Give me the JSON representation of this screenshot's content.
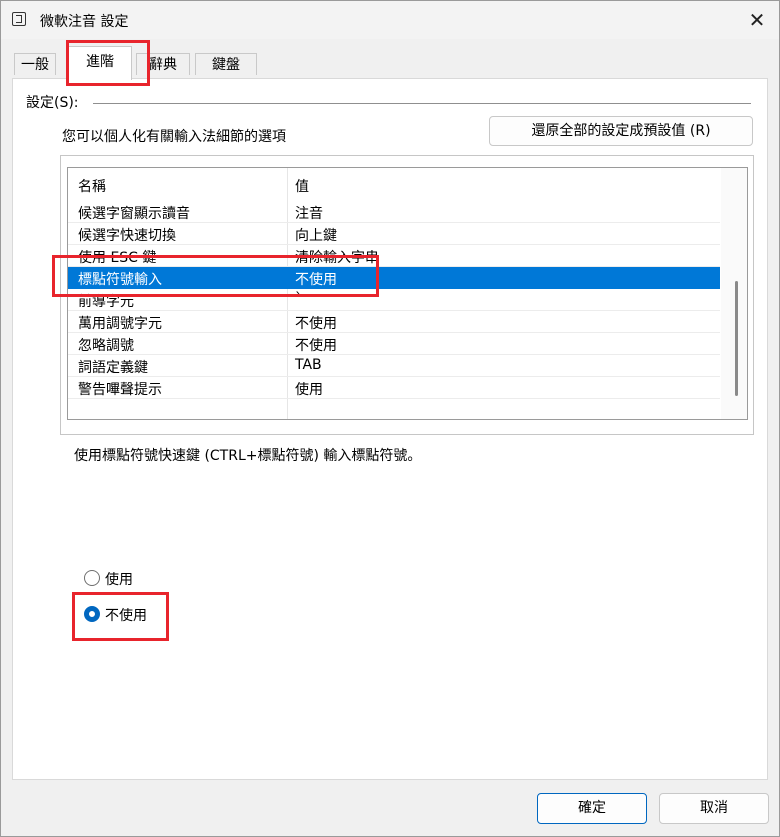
{
  "window": {
    "title": "微軟注音 設定",
    "close_glyph": "✕"
  },
  "tabs": [
    {
      "label": "一般"
    },
    {
      "label": "進階"
    },
    {
      "label": "辭典"
    },
    {
      "label": "鍵盤"
    }
  ],
  "settings": {
    "group_label": "設定(S):",
    "description": "您可以個人化有關輸入法細節的選項",
    "restore_button": "還原全部的設定成預設值 (R)",
    "columns": {
      "name": "名稱",
      "value": "值"
    },
    "rows": [
      {
        "name": "候選字窗顯示讀音",
        "value": "注音"
      },
      {
        "name": "候選字快速切換",
        "value": "向上鍵"
      },
      {
        "name": "使用 ESC 鍵",
        "value": "清除輸入字串"
      },
      {
        "name": "標點符號輸入",
        "value": "不使用"
      },
      {
        "name": "前導字元",
        "value": "`"
      },
      {
        "name": "萬用調號字元",
        "value": "不使用"
      },
      {
        "name": "忽略調號",
        "value": "不使用"
      },
      {
        "name": "詞語定義鍵",
        "value": "TAB"
      },
      {
        "name": "警告嗶聲提示",
        "value": "使用"
      }
    ],
    "selected_row": "標點符號輸入",
    "hint": "使用標點符號快速鍵 (CTRL+標點符號) 輸入標點符號。",
    "options": [
      {
        "label": "使用",
        "checked": false
      },
      {
        "label": "不使用",
        "checked": true
      }
    ]
  },
  "footer": {
    "ok": "確定",
    "cancel": "取消"
  },
  "colors": {
    "selection": "#0078d7",
    "annotation": "#e8242c",
    "accent": "#0067c0"
  }
}
